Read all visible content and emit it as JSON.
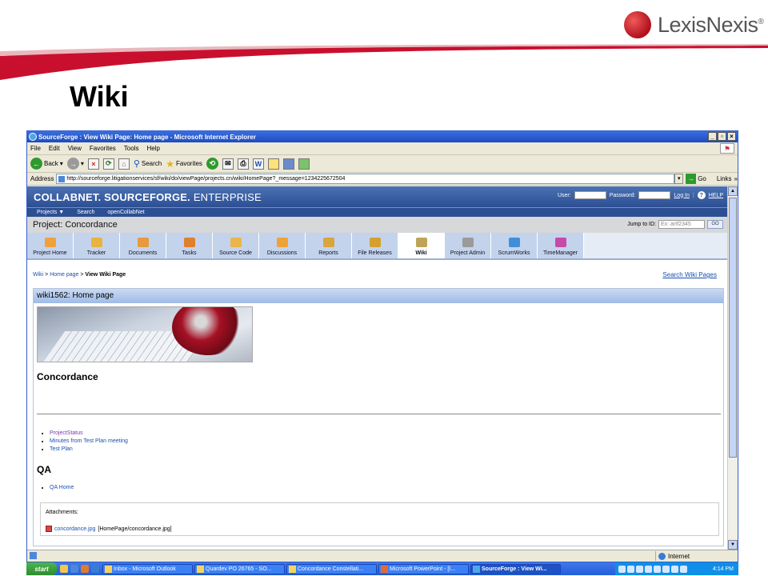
{
  "slide": {
    "title": "Wiki",
    "logo_text": "LexisNexis",
    "logo_mark": "®"
  },
  "window": {
    "title": "SourceForge : View Wiki Page: Home page - Microsoft Internet Explorer",
    "menu": [
      "File",
      "Edit",
      "View",
      "Favorites",
      "Tools",
      "Help"
    ],
    "toolbar": {
      "back": "Back",
      "search": "Search",
      "favorites": "Favorites"
    },
    "address_label": "Address",
    "address_url": "http://sourceforge.litigationservices/sf/wiki/do/viewPage/projects.cn/wiki/HomePage?_message=1234225672504",
    "go_label": "Go",
    "links_label": "Links",
    "status_zone": "Internet"
  },
  "sf": {
    "logo_brand": "COLLABNET. SOURCEFORGE.",
    "logo_edition": "ENTERPRISE",
    "user_label": "User:",
    "password_label": "Password:",
    "login_link": "Log In",
    "help_link": "HELP",
    "nav": [
      "Projects",
      "Search",
      "openCollabNet"
    ],
    "project_title": "Project: Concordance",
    "jump_label": "Jump to ID:",
    "jump_placeholder": "Ex: artf2345",
    "jump_go": "GO",
    "tabs": [
      {
        "label": "Project Home",
        "color": "#f0a23a"
      },
      {
        "label": "Tracker",
        "color": "#e8b341"
      },
      {
        "label": "Documents",
        "color": "#e89a3c"
      },
      {
        "label": "Tasks",
        "color": "#e07f2c"
      },
      {
        "label": "Source Code",
        "color": "#eab54a"
      },
      {
        "label": "Discussions",
        "color": "#f0a23a"
      },
      {
        "label": "Reports",
        "color": "#d9a53e"
      },
      {
        "label": "File Releases",
        "color": "#d6a030"
      },
      {
        "label": "Wiki",
        "color": "#bfa35a"
      },
      {
        "label": "Project Admin",
        "color": "#9a9a9a"
      },
      {
        "label": "ScrumWorks",
        "color": "#3f8fd8"
      },
      {
        "label": "TimeManager",
        "color": "#c64aa6"
      }
    ],
    "active_tab": "Wiki"
  },
  "breadcrumb": {
    "wiki": "Wiki",
    "sep": ">",
    "home": "Home page",
    "current": "View Wiki Page"
  },
  "search_wiki": "Search Wiki Pages",
  "wiki": {
    "page_id_title": "wiki1562: Home page",
    "heading1": "Concordance",
    "links1": [
      {
        "text": "ProjectStatus",
        "visited": true
      },
      {
        "text": "Minutes from Test Plan meeting",
        "visited": false
      },
      {
        "text": "Test Plan",
        "visited": false
      }
    ],
    "heading2": "QA",
    "links2": [
      {
        "text": "QA Home"
      }
    ],
    "attachments_label": "Attachments:",
    "attachment_file": "concordance.jpg",
    "attachment_path": "[HomePage/concordance.jpg]"
  },
  "taskbar": {
    "start": "start",
    "tasks": [
      {
        "text": "Inbox - Microsoft Outlook",
        "active": false
      },
      {
        "text": "Quardev PO 26765 - SO...",
        "active": false
      },
      {
        "text": "Concordance Constellati...",
        "active": false
      },
      {
        "text": "Microsoft PowerPoint - [I...",
        "active": false
      },
      {
        "text": "SourceForge : View Wi...",
        "active": true
      }
    ],
    "clock": "4:14 PM"
  }
}
